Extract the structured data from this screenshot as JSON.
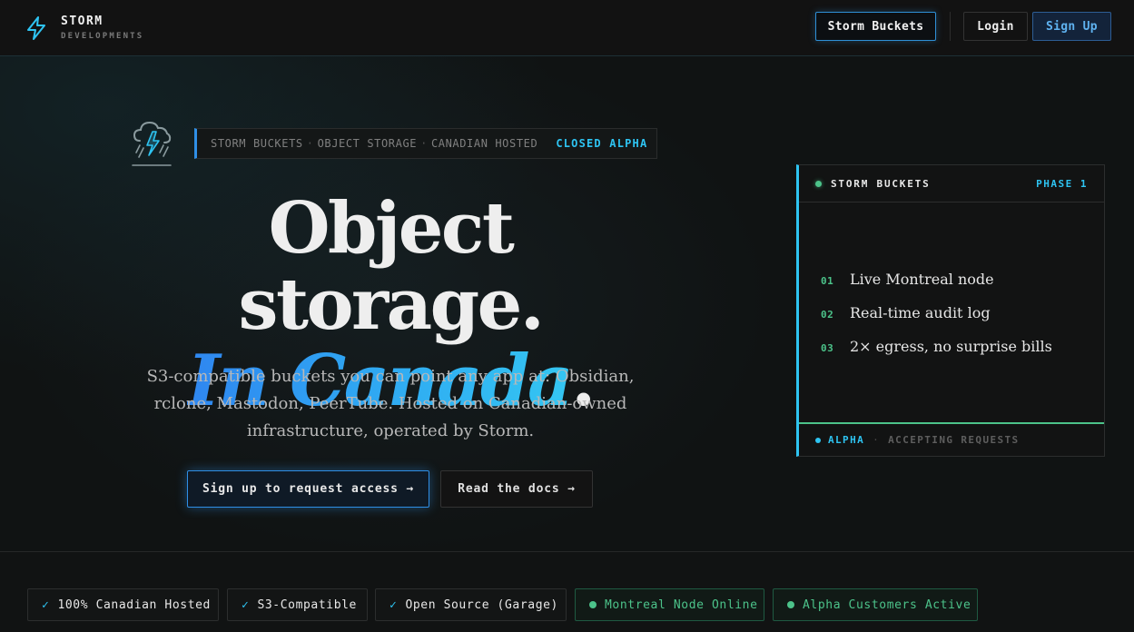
{
  "header": {
    "brand_name": "STORM",
    "brand_sub": "DEVELOPMENTS",
    "brand_icon": "lightning-bolt-icon",
    "nav_buckets": "Storm Buckets",
    "nav_login": "Login",
    "nav_signup": "Sign Up"
  },
  "hero": {
    "logo_icon": "storm-cloud-icon",
    "tagline": {
      "items": [
        "STORM BUCKETS",
        "OBJECT STORAGE",
        "CANADIAN HOSTED"
      ],
      "separator": "·",
      "status": "CLOSED ALPHA"
    },
    "title_line1": "Object storage.",
    "title_line2": "In Canada",
    "title_line2_suffix": ".",
    "description": "S3-compatible buckets you can point any app at: Obsidian, rclone, Mastodon, PeerTube. Hosted on Canadian-owned infrastructure, operated by Storm.",
    "cta_primary": "Sign up to request access →",
    "cta_secondary": "Read the docs →"
  },
  "card": {
    "title": "STORM BUCKETS",
    "phase": "PHASE 1",
    "features": [
      {
        "num": "01",
        "text": "Live Montreal node"
      },
      {
        "num": "02",
        "text": "Real-time audit log"
      },
      {
        "num": "03",
        "text": "2× egress, no surprise bills"
      }
    ],
    "footer_status": "ALPHA",
    "footer_separator": "·",
    "footer_text": "ACCEPTING REQUESTS"
  },
  "badges": [
    {
      "icon": "✓",
      "label": "100% Canadian Hosted"
    },
    {
      "icon": "✓",
      "label": "S3-Compatible"
    },
    {
      "icon": "✓",
      "label": "Open Source (Garage)"
    },
    {
      "label": "Montreal Node Online"
    },
    {
      "label": "Alpha Customers Active"
    }
  ],
  "colors": {
    "accent_blue": "#2f8fe6",
    "accent_cyan": "#2ec4f2",
    "accent_green": "#4cc38a",
    "background": "#101313"
  }
}
